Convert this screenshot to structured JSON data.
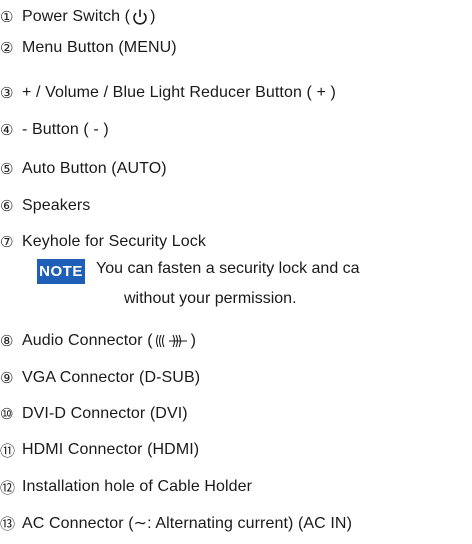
{
  "items": [
    {
      "num": "①",
      "text_before": "Power Switch (",
      "icon": "power-icon",
      "text_after": ")"
    },
    {
      "num": "②",
      "text": "Menu Button (MENU)"
    },
    {
      "num": "③",
      "text": "+ / Volume / Blue Light Reducer Button ( + )"
    },
    {
      "num": "④",
      "text": "- Button ( - )"
    },
    {
      "num": "⑤",
      "text": "Auto Button (AUTO)"
    },
    {
      "num": "⑥",
      "text": "Speakers"
    },
    {
      "num": "⑦",
      "text": "Keyhole for Security Lock"
    },
    {
      "num": "⑧",
      "text_before": "Audio Connector (",
      "icon": "audio-icon",
      "text_after": ")"
    },
    {
      "num": "⑨",
      "text": "VGA Connector (D-SUB)"
    },
    {
      "num": "⑩",
      "text": "DVI-D Connector (DVI)"
    },
    {
      "num": "⑪",
      "text": "HDMI Connector (HDMI)"
    },
    {
      "num": "⑫",
      "text": "Installation hole of Cable Holder"
    },
    {
      "num": "⑬",
      "text": "AC Connector (∼: Alternating current) (AC IN)"
    }
  ],
  "note": {
    "badge": "NOTE",
    "line1": "You can fasten a security lock and ca",
    "line2": "without your permission."
  }
}
